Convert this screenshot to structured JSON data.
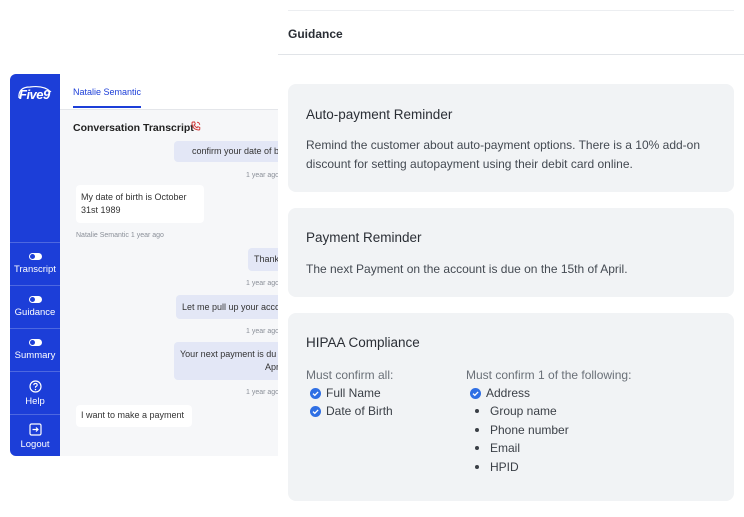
{
  "agent": {
    "logo": "Five9",
    "tab_label": "Natalie Semantic",
    "transcript_title": "Conversation Transcript",
    "nav": [
      {
        "label": "Transcript",
        "icon": "toggle-icon"
      },
      {
        "label": "Guidance",
        "icon": "toggle-icon"
      },
      {
        "label": "Summary",
        "icon": "toggle-icon"
      },
      {
        "label": "Help",
        "icon": "help-circle-icon"
      },
      {
        "label": "Logout",
        "icon": "logout-icon"
      }
    ],
    "messages": {
      "m1": "confirm your date of b",
      "m1_time": "1 year ago",
      "m2": "My date of birth is October 31st 1989",
      "m2_meta": "Natalie Semantic",
      "m2_time": "1 year ago",
      "m3": "Thank",
      "m3_time": "1 year ago",
      "m4": "Let me pull up your acco",
      "m4_time": "1 year ago",
      "m5_line1": "Your next payment is du",
      "m5_line2": "April",
      "m5_time": "1 year ago",
      "m6": "I want to make a payment"
    }
  },
  "guidance": {
    "header": "Guidance",
    "cards": [
      {
        "title": "Auto-payment Reminder",
        "text": "Remind the customer about auto-payment options. There is a 10% add-on discount for setting autopayment using their debit card online."
      },
      {
        "title": "Payment Reminder",
        "text": "The next Payment on the account is due on the 15th of April."
      }
    ],
    "hipaa": {
      "title": "HIPAA Compliance",
      "left_heading": "Must confirm all:",
      "left_items": [
        "Full Name",
        "Date of Birth"
      ],
      "right_heading": "Must confirm 1 of the following:",
      "right_checked": "Address",
      "right_items": [
        "Group name",
        "Phone number",
        "Email",
        "HPID"
      ]
    }
  },
  "colors": {
    "brand_blue": "#1c3ed8",
    "check_blue": "#2f6fe4",
    "card_bg": "#f1f3f5"
  }
}
